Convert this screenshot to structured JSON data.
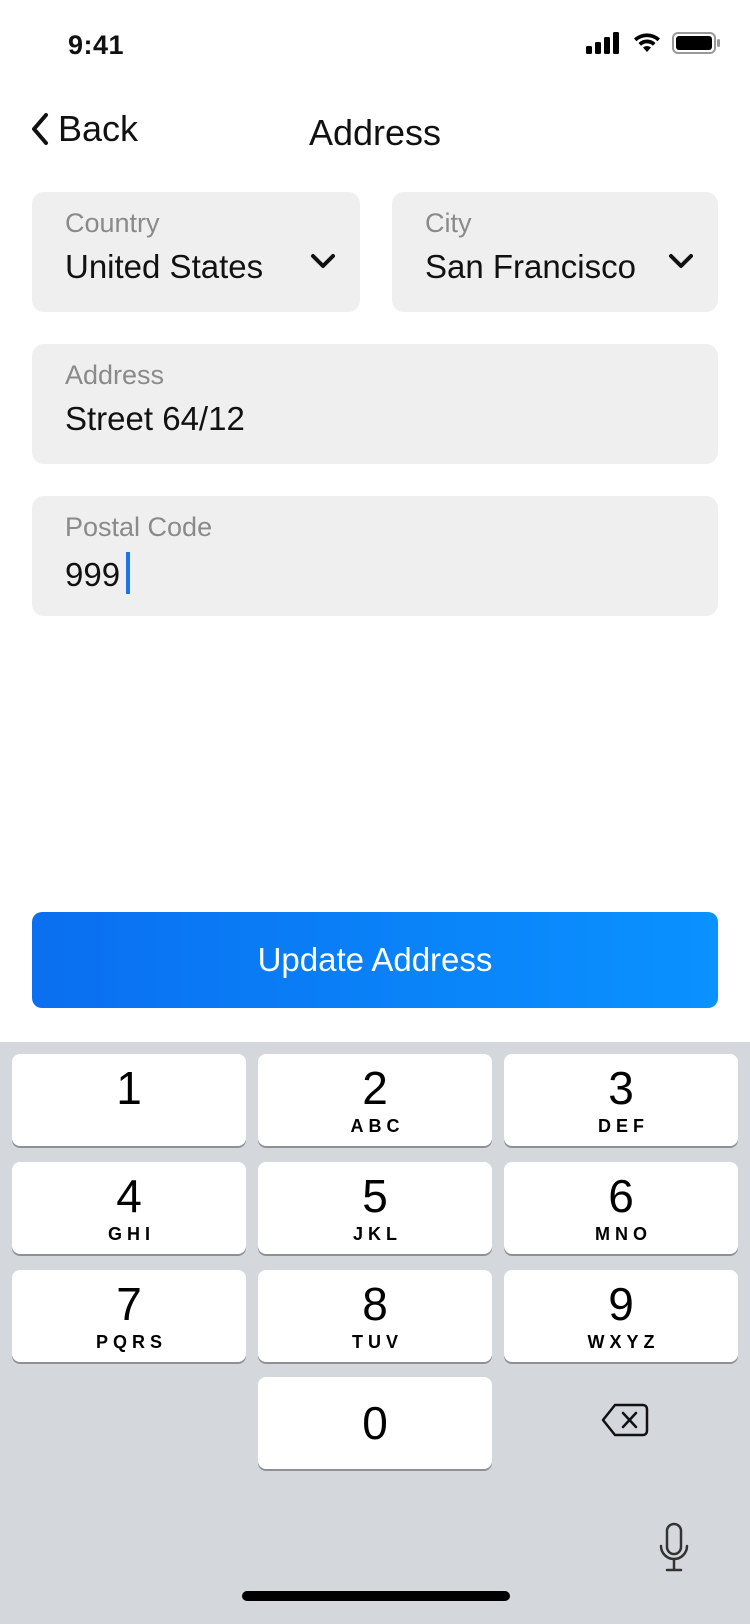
{
  "status_bar": {
    "time": "9:41",
    "icons": [
      "signal-icon",
      "wifi-icon",
      "battery-icon"
    ]
  },
  "nav": {
    "back_label": "Back",
    "title": "Address"
  },
  "form": {
    "country": {
      "label": "Country",
      "value": "United States"
    },
    "city": {
      "label": "City",
      "value": "San Francisco"
    },
    "address": {
      "label": "Address",
      "value": "Street 64/12"
    },
    "postal_code": {
      "label": "Postal Code",
      "value": "999"
    }
  },
  "update_button": {
    "label": "Update Address",
    "colors": [
      "#0a6ff0",
      "#0a92ff"
    ]
  },
  "keyboard": {
    "keys": [
      {
        "digit": "1",
        "letters": ""
      },
      {
        "digit": "2",
        "letters": "ABC"
      },
      {
        "digit": "3",
        "letters": "DEF"
      },
      {
        "digit": "4",
        "letters": "GHI"
      },
      {
        "digit": "5",
        "letters": "JKL"
      },
      {
        "digit": "6",
        "letters": "MNO"
      },
      {
        "digit": "7",
        "letters": "PQRS"
      },
      {
        "digit": "8",
        "letters": "TUV"
      },
      {
        "digit": "9",
        "letters": "WXYZ"
      },
      {
        "digit": "0",
        "letters": ""
      }
    ],
    "icons": [
      "delete-icon",
      "microphone-icon"
    ]
  },
  "colors": {
    "accent": "#1a73e8",
    "field_bg": "#efefef",
    "keyboard_bg": "#d4d7dc"
  }
}
